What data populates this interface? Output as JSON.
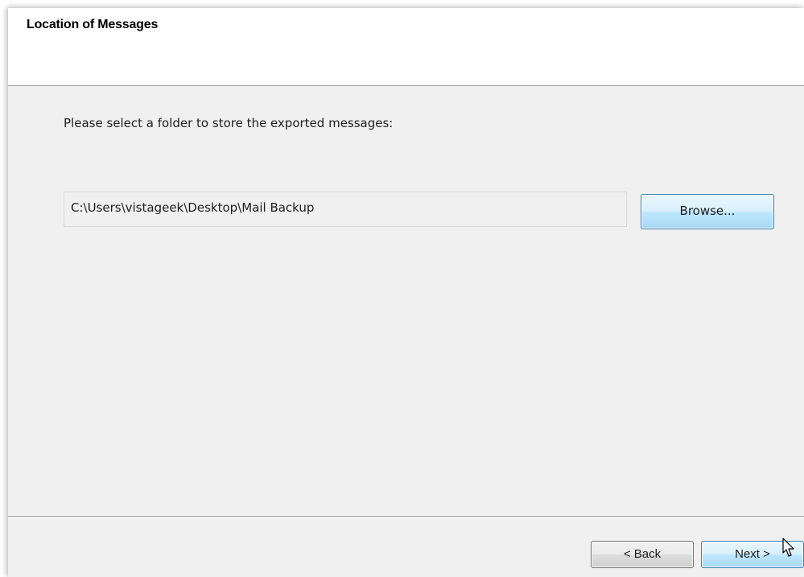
{
  "header": {
    "title": "Location of Messages"
  },
  "body": {
    "prompt": "Please select a folder to store the exported messages:",
    "folder_path": "C:\\Users\\vistageek\\Desktop\\Mail Backup",
    "browse_label": "Browse..."
  },
  "footer": {
    "back_label": "< Back",
    "next_label": "Next >"
  },
  "icons": {
    "cursor": "arrow-cursor-icon"
  },
  "colors": {
    "dialog_background": "#f0f0f0",
    "header_background": "#ffffff",
    "button_highlight_border": "#3c7fb1"
  }
}
